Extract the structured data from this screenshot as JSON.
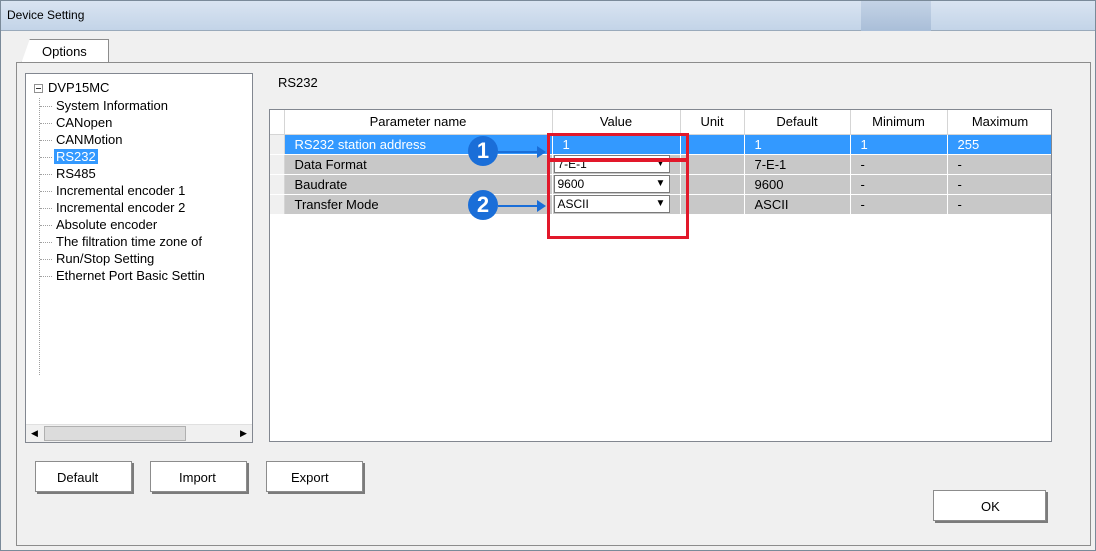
{
  "window": {
    "title": "Device Setting"
  },
  "tabs": [
    {
      "label": "Options"
    }
  ],
  "tree": {
    "root": "DVP15MC",
    "items": [
      {
        "label": "System Information"
      },
      {
        "label": "CANopen"
      },
      {
        "label": "CANMotion"
      },
      {
        "label": "RS232",
        "selected": true
      },
      {
        "label": "RS485"
      },
      {
        "label": "Incremental encoder 1"
      },
      {
        "label": "Incremental encoder 2"
      },
      {
        "label": "Absolute encoder"
      },
      {
        "label": "The filtration time zone of"
      },
      {
        "label": "Run/Stop Setting"
      },
      {
        "label": "Ethernet Port Basic Settin"
      }
    ]
  },
  "section": {
    "title": "RS232"
  },
  "table": {
    "columns": [
      "Parameter name",
      "Value",
      "Unit",
      "Default",
      "Minimum",
      "Maximum"
    ],
    "rows": [
      {
        "name": "RS232 station address",
        "value": "1",
        "unit": "",
        "default": "1",
        "min": "1",
        "max": "255",
        "selected": true,
        "combo": false
      },
      {
        "name": "Data Format",
        "value": "7-E-1",
        "unit": "",
        "default": "7-E-1",
        "min": "-",
        "max": "-",
        "combo": true
      },
      {
        "name": "Baudrate",
        "value": "9600",
        "unit": "",
        "default": "9600",
        "min": "-",
        "max": "-",
        "combo": true
      },
      {
        "name": "Transfer Mode",
        "value": "ASCII",
        "unit": "",
        "default": "ASCII",
        "min": "-",
        "max": "-",
        "combo": true
      }
    ]
  },
  "callouts": {
    "one": "1",
    "two": "2"
  },
  "buttons": {
    "default": "Default",
    "import": "Import",
    "export": "Export",
    "ok": "OK"
  },
  "colors": {
    "selection": "#3399ff",
    "highlight_box": "#e2182a",
    "callout": "#1a6ed8"
  }
}
